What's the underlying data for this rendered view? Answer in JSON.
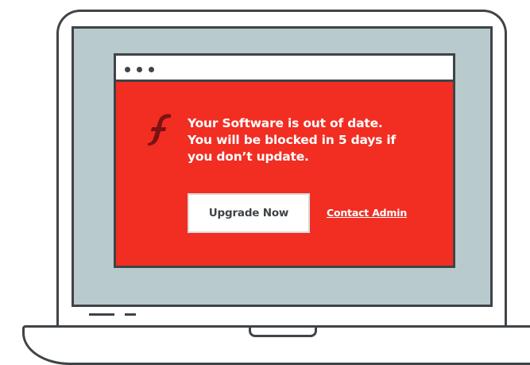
{
  "browser": {
    "window_dots": [
      "dot",
      "dot",
      "dot"
    ]
  },
  "alert": {
    "icon": "flash-player-icon",
    "message_lines": [
      "Your Software is out of date.",
      "You will be blocked in 5 days if",
      "you don’t update."
    ],
    "primary_button_label": "Upgrade Now",
    "secondary_link_label": "Contact Admin"
  },
  "colors": {
    "alert_background": "#f22d22",
    "outline": "#3f4448",
    "screen_background": "#b8cacc",
    "icon_color": "#7a1212"
  }
}
